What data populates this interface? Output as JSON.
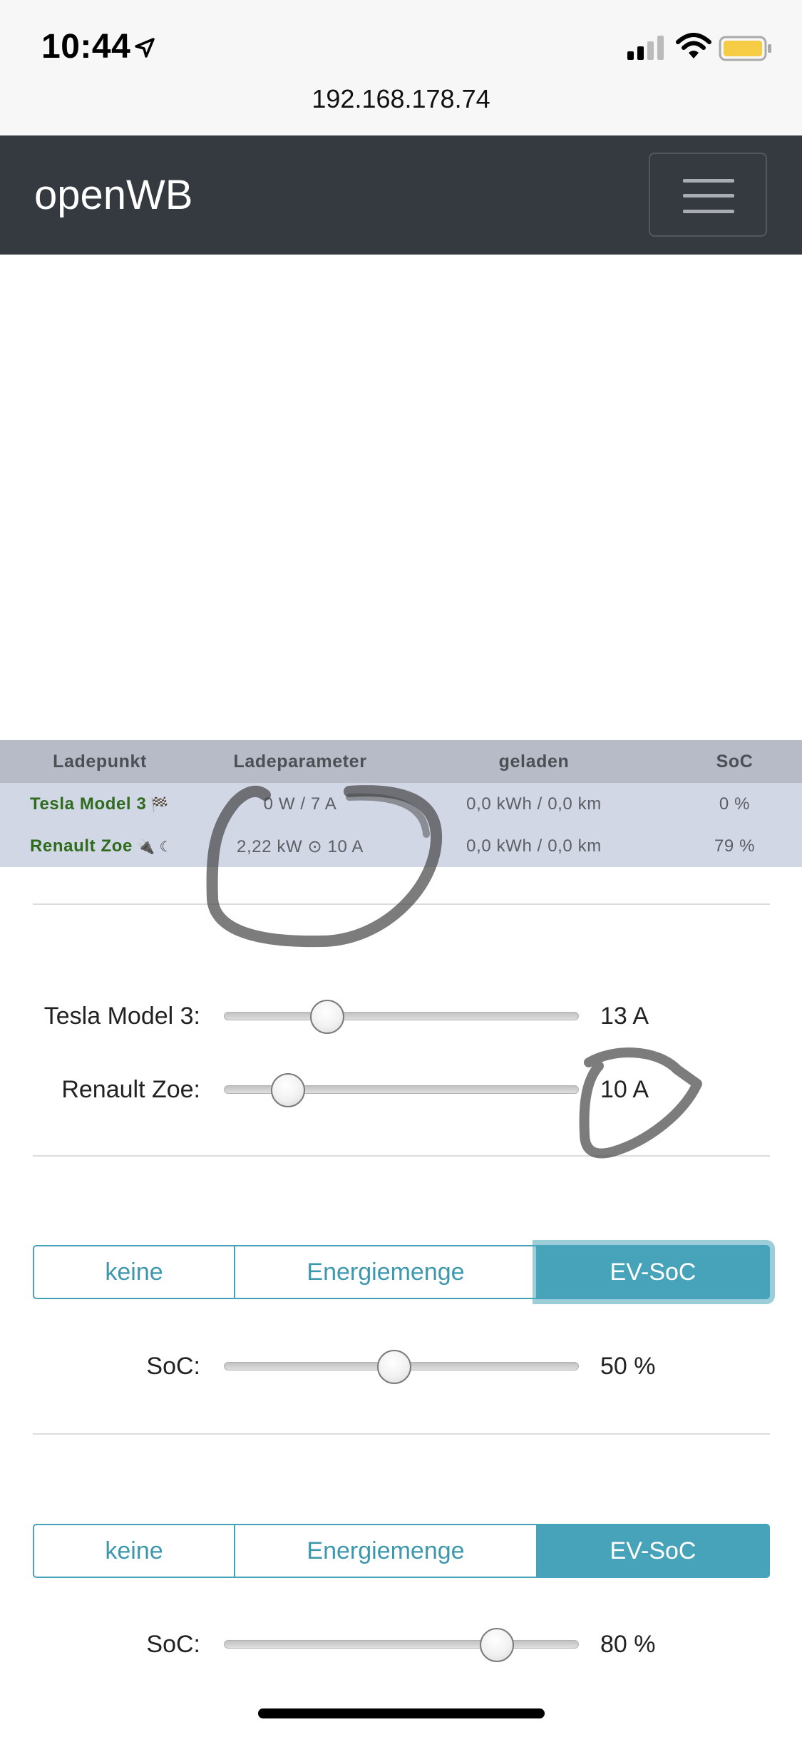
{
  "status_bar": {
    "time": "10:44",
    "url": "192.168.178.74",
    "icons": [
      "location-arrow-icon",
      "cellular-signal-icon",
      "wifi-icon",
      "battery-icon"
    ]
  },
  "navbar": {
    "brand": "openWB",
    "menu_icon": "hamburger-menu-icon",
    "bg_color": "#343a40"
  },
  "charge_table": {
    "headers": [
      "Ladepunkt",
      "Ladeparameter",
      "geladen",
      "SoC"
    ],
    "rows": [
      {
        "name": "Tesla Model 3",
        "symbol": "🏁",
        "params": "0 W / 7 A",
        "charged": "0,0 kWh / 0,0 km",
        "soc": "0 %"
      },
      {
        "name": "Renault Zoe",
        "symbol": "🔌 ☾",
        "params": "2,22 kW ⊙ 10 A",
        "charged": "0,0 kWh / 0,0 km",
        "soc": "79 %"
      }
    ]
  },
  "current_sliders": [
    {
      "label": "Tesla Model 3:",
      "value": "13 A",
      "fraction": 0.29
    },
    {
      "label": "Renault Zoe:",
      "value": "10 A",
      "fraction": 0.18
    }
  ],
  "target_groups": [
    {
      "options": [
        "keine",
        "Energiemenge",
        "EV-SoC"
      ],
      "selected": "EV-SoC",
      "soc_label": "SoC:",
      "soc_value": "50 %",
      "fraction": 0.48
    },
    {
      "options": [
        "keine",
        "Energiemenge",
        "EV-SoC"
      ],
      "selected": "EV-SoC",
      "soc_label": "SoC:",
      "soc_value": "80 %",
      "fraction": 0.77
    }
  ],
  "colors": {
    "accent": "#47a3b9",
    "vehicle_name": "#2e6b1c",
    "table_header": "#b6bbc7",
    "table_body": "#d2d7e6"
  }
}
